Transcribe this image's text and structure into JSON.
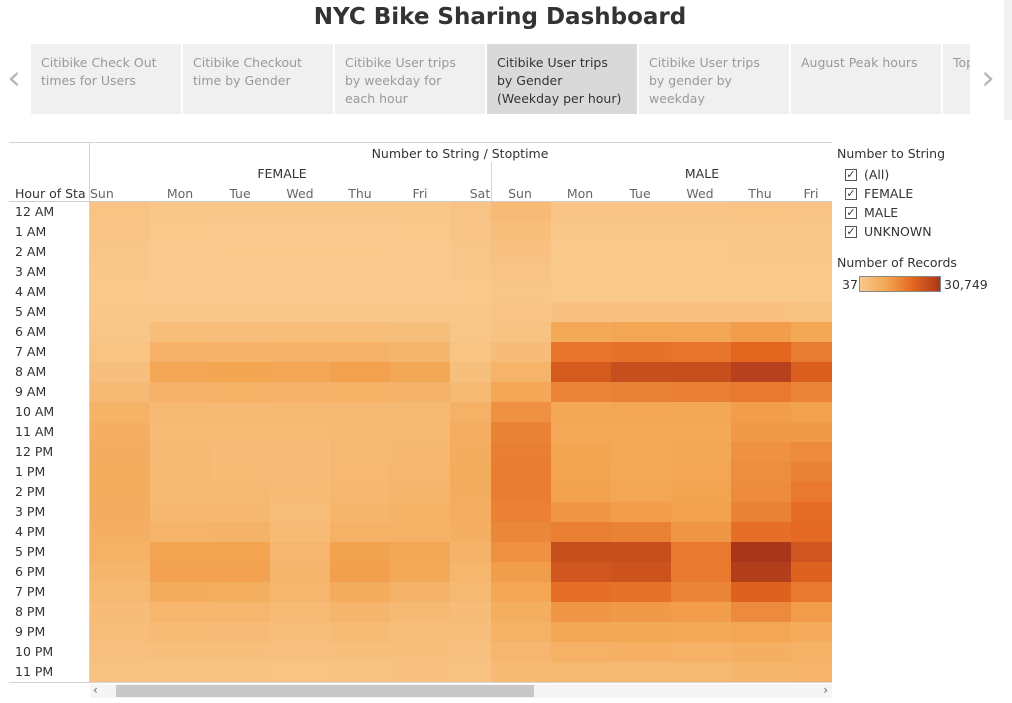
{
  "title": "NYC Bike Sharing Dashboard",
  "tabs": [
    {
      "label": "Citibike Check Out times for Users",
      "active": false
    },
    {
      "label": "Citibike Checkout time by Gender",
      "active": false
    },
    {
      "label": "Citibike User trips by weekday for each hour",
      "active": false
    },
    {
      "label": "Citibike User trips by Gender (Weekday per hour)",
      "active": true
    },
    {
      "label": "Citibike User trips by gender by weekday",
      "active": false
    },
    {
      "label": "August Peak hours",
      "active": false
    },
    {
      "label": "Top",
      "active": false
    }
  ],
  "icons": {
    "prev": "chevron-left-icon",
    "next": "chevron-right-icon",
    "check": "checkmark-icon"
  },
  "chart_data": {
    "type": "heatmap",
    "column_header": "Number to String  /  Stoptime",
    "row_header": "Hour of Sta..",
    "groups": [
      "FEMALE",
      "MALE"
    ],
    "days_female": [
      "Sun",
      "Mon",
      "Tue",
      "Wed",
      "Thu",
      "Fri",
      "Sat"
    ],
    "days_male": [
      "Sun",
      "Mon",
      "Tue",
      "Wed",
      "Thu",
      "Fri"
    ],
    "hours": [
      "12 AM",
      "1 AM",
      "2 AM",
      "3 AM",
      "4 AM",
      "5 AM",
      "6 AM",
      "7 AM",
      "8 AM",
      "9 AM",
      "10 AM",
      "11 AM",
      "12 PM",
      "1 PM",
      "2 PM",
      "3 PM",
      "4 PM",
      "5 PM",
      "6 PM",
      "7 PM",
      "8 PM",
      "9 PM",
      "10 PM",
      "11 PM"
    ],
    "female_values": [
      [
        1800,
        600,
        500,
        500,
        500,
        600,
        1500
      ],
      [
        1300,
        300,
        200,
        200,
        200,
        300,
        1100
      ],
      [
        900,
        200,
        150,
        150,
        150,
        200,
        800
      ],
      [
        600,
        100,
        80,
        80,
        80,
        100,
        500
      ],
      [
        400,
        100,
        80,
        80,
        80,
        100,
        400
      ],
      [
        500,
        700,
        700,
        700,
        700,
        600,
        500
      ],
      [
        900,
        3300,
        3400,
        3300,
        3300,
        3000,
        900
      ],
      [
        1700,
        6500,
        6500,
        6200,
        6500,
        5800,
        1800
      ],
      [
        2800,
        10000,
        10300,
        10000,
        11000,
        9500,
        3000
      ],
      [
        4200,
        6500,
        6700,
        6500,
        6800,
        6300,
        4300
      ],
      [
        6400,
        4200,
        4300,
        4300,
        4500,
        4300,
        6800
      ],
      [
        7400,
        4000,
        4100,
        4000,
        4300,
        4300,
        7600
      ],
      [
        7900,
        4400,
        3800,
        3800,
        4600,
        5000,
        8100
      ],
      [
        8100,
        4600,
        4000,
        3800,
        4800,
        5300,
        8300
      ],
      [
        8100,
        4700,
        4600,
        4000,
        5000,
        5600,
        8100
      ],
      [
        7900,
        5000,
        5100,
        3300,
        5600,
        6400,
        7700
      ],
      [
        7400,
        6100,
        6200,
        4000,
        6700,
        6900,
        7300
      ],
      [
        6800,
        10300,
        10500,
        5300,
        10600,
        9500,
        6200
      ],
      [
        5800,
        10700,
        10700,
        5600,
        11100,
        9000,
        5400
      ],
      [
        4700,
        8000,
        7800,
        5400,
        8000,
        6300,
        4600
      ],
      [
        3800,
        5500,
        5400,
        4000,
        5600,
        4200,
        3800
      ],
      [
        3100,
        4000,
        3900,
        3300,
        4000,
        3400,
        3100
      ],
      [
        2600,
        3000,
        3000,
        2600,
        3000,
        2900,
        2600
      ],
      [
        2000,
        1900,
        2000,
        1700,
        2000,
        2300,
        2100
      ]
    ],
    "male_values": [
      [
        3900,
        1300,
        1300,
        1300,
        1700,
        1500
      ],
      [
        3000,
        700,
        700,
        700,
        900,
        900
      ],
      [
        2200,
        400,
        400,
        400,
        500,
        500
      ],
      [
        1500,
        300,
        300,
        300,
        300,
        300
      ],
      [
        1000,
        300,
        300,
        300,
        300,
        300
      ],
      [
        1100,
        2200,
        2300,
        2200,
        2200,
        2100
      ],
      [
        1900,
        9200,
        10000,
        10000,
        11500,
        9500
      ],
      [
        3600,
        18000,
        18500,
        18000,
        20500,
        17000
      ],
      [
        6000,
        23000,
        25500,
        25500,
        28500,
        22000
      ],
      [
        9400,
        15500,
        16000,
        16500,
        17500,
        15500
      ],
      [
        13500,
        9500,
        9600,
        9500,
        11500,
        11000
      ],
      [
        15800,
        9200,
        9000,
        9000,
        12000,
        12000
      ],
      [
        16500,
        10200,
        9000,
        9500,
        13500,
        14500
      ],
      [
        17000,
        10500,
        9200,
        9600,
        14000,
        16000
      ],
      [
        16800,
        11000,
        10000,
        10500,
        14500,
        17500
      ],
      [
        16200,
        12500,
        11500,
        11000,
        16000,
        19500
      ],
      [
        15100,
        16500,
        16000,
        12500,
        19000,
        20000
      ],
      [
        13600,
        25500,
        25500,
        17500,
        30749,
        24000
      ],
      [
        11400,
        24000,
        24500,
        17500,
        29000,
        21500
      ],
      [
        9800,
        19000,
        18500,
        15500,
        21500,
        17500
      ],
      [
        7800,
        12500,
        12000,
        11500,
        14500,
        11500
      ],
      [
        6600,
        9500,
        9500,
        9000,
        10000,
        8500
      ],
      [
        5300,
        7000,
        7200,
        6900,
        7500,
        7000
      ],
      [
        4200,
        4700,
        4600,
        4700,
        5600,
        6000
      ]
    ]
  },
  "legend": {
    "filter_title": "Number to String",
    "items": [
      "(All)",
      "FEMALE",
      "MALE",
      "UNKNOWN"
    ],
    "color_title": "Number of Records",
    "min": "37",
    "max": "30,749",
    "colors": [
      "#f9c98d",
      "#f3a552",
      "#e3661f",
      "#a9361b"
    ]
  }
}
